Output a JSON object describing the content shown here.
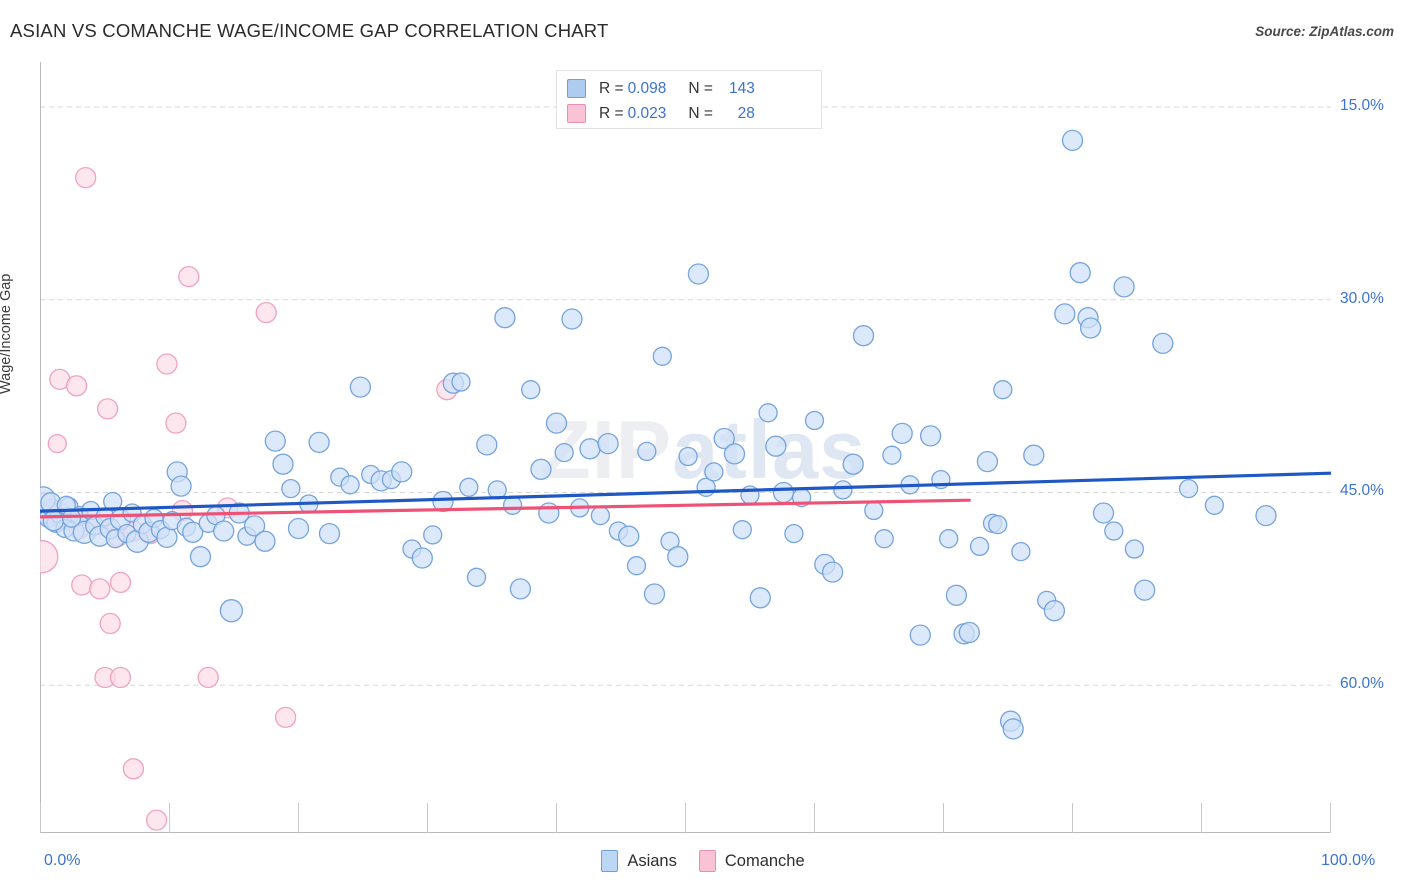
{
  "header": {
    "title": "ASIAN VS COMANCHE WAGE/INCOME GAP CORRELATION CHART",
    "source": "Source: ZipAtlas.com"
  },
  "watermark": {
    "part1": "ZIP",
    "part2": "atlas"
  },
  "stats_legend": {
    "rows": [
      {
        "series": "Asians",
        "r_label": "R =",
        "r_value": "0.098",
        "n_label": "N =",
        "n_value": "143",
        "color": "#aecbf0"
      },
      {
        "series": "Comanche",
        "r_label": "R =",
        "r_value": "0.023",
        "n_label": "N =",
        "n_value": "28",
        "color": "#f9c2d5"
      }
    ]
  },
  "series_legend": [
    {
      "label": "Asians",
      "color": "#bcd6f5",
      "border": "#6f9fdb"
    },
    {
      "label": "Comanche",
      "color": "#f9c2d5",
      "border": "#e58fb2"
    }
  ],
  "axes": {
    "y_title": "Wage/Income Gap",
    "y_ticks": [
      "60.0%",
      "45.0%",
      "30.0%",
      "15.0%"
    ],
    "x_min": "0.0%",
    "x_max": "100.0%"
  },
  "chart_data": {
    "type": "scatter",
    "title": "ASIAN VS COMANCHE WAGE/INCOME GAP CORRELATION CHART",
    "xlabel": "",
    "ylabel": "Wage/Income Gap",
    "xlim": [
      0,
      100
    ],
    "ylim": [
      3.5,
      63.5
    ],
    "grid": true,
    "x_tick_values": [
      0,
      100
    ],
    "y_tick_values": [
      15,
      30,
      45,
      60
    ],
    "legend_position": "bottom-center",
    "series": [
      {
        "name": "Asians",
        "color": "#cfe1f8",
        "border": "#6f9fdb",
        "r": 0.098,
        "n": 143,
        "trendline": {
          "x0": 0,
          "y0": 28.55,
          "x1": 100,
          "y1": 31.5,
          "color": "#1f58c4"
        },
        "points": [
          [
            0.3,
            28.3,
            9
          ],
          [
            0.6,
            28.0,
            9
          ],
          [
            0.9,
            28.8,
            9
          ],
          [
            1.2,
            27.6,
            9
          ],
          [
            1.5,
            28.4,
            10
          ],
          [
            1.9,
            27.2,
            9
          ],
          [
            2.2,
            28.9,
            9
          ],
          [
            2.6,
            27.0,
            10
          ],
          [
            3.0,
            28.2,
            9
          ],
          [
            3.4,
            26.9,
            11
          ],
          [
            3.9,
            28.6,
            9
          ],
          [
            4.2,
            27.4,
            9
          ],
          [
            4.6,
            26.6,
            10
          ],
          [
            5.0,
            28.1,
            9
          ],
          [
            5.4,
            27.2,
            10
          ],
          [
            5.8,
            26.4,
            9
          ],
          [
            6.2,
            27.9,
            10
          ],
          [
            6.7,
            26.8,
            9
          ],
          [
            7.1,
            28.4,
            9
          ],
          [
            7.5,
            26.2,
            11
          ],
          [
            7.9,
            27.5,
            9
          ],
          [
            8.4,
            26.9,
            10
          ],
          [
            8.8,
            28.0,
            9
          ],
          [
            9.3,
            27.1,
            9
          ],
          [
            9.8,
            26.5,
            10
          ],
          [
            10.2,
            27.8,
            9
          ],
          [
            10.6,
            31.6,
            10
          ],
          [
            10.9,
            30.5,
            10
          ],
          [
            11.3,
            27.3,
            9
          ],
          [
            11.8,
            26.9,
            10
          ],
          [
            12.4,
            25.0,
            10
          ],
          [
            13.0,
            27.6,
            9
          ],
          [
            13.6,
            28.2,
            9
          ],
          [
            14.2,
            27.0,
            10
          ],
          [
            14.8,
            20.8,
            11
          ],
          [
            15.4,
            28.4,
            10
          ],
          [
            16.0,
            26.6,
            9
          ],
          [
            16.6,
            27.4,
            10
          ],
          [
            17.4,
            26.2,
            10
          ],
          [
            18.2,
            34.0,
            10
          ],
          [
            18.8,
            32.2,
            10
          ],
          [
            19.4,
            30.3,
            9
          ],
          [
            20.0,
            27.2,
            10
          ],
          [
            20.8,
            29.1,
            9
          ],
          [
            21.6,
            33.9,
            10
          ],
          [
            22.4,
            26.8,
            10
          ],
          [
            23.2,
            31.2,
            9
          ],
          [
            24.0,
            30.6,
            9
          ],
          [
            24.8,
            38.2,
            10
          ],
          [
            25.6,
            31.4,
            9
          ],
          [
            26.4,
            30.9,
            10
          ],
          [
            27.2,
            31.0,
            9
          ],
          [
            28.0,
            31.6,
            10
          ],
          [
            28.8,
            25.6,
            9
          ],
          [
            29.6,
            24.9,
            10
          ],
          [
            30.4,
            26.7,
            9
          ],
          [
            31.2,
            29.3,
            10
          ],
          [
            32.0,
            38.5,
            10
          ],
          [
            32.6,
            38.6,
            9
          ],
          [
            33.2,
            30.4,
            9
          ],
          [
            33.8,
            23.4,
            9
          ],
          [
            34.6,
            33.7,
            10
          ],
          [
            35.4,
            30.2,
            9
          ],
          [
            36.0,
            43.6,
            10
          ],
          [
            36.6,
            29.0,
            9
          ],
          [
            37.2,
            22.5,
            10
          ],
          [
            38.0,
            38.0,
            9
          ],
          [
            38.8,
            31.8,
            10
          ],
          [
            39.4,
            28.4,
            10
          ],
          [
            40.0,
            35.4,
            10
          ],
          [
            40.6,
            33.1,
            9
          ],
          [
            41.2,
            43.5,
            10
          ],
          [
            41.8,
            28.8,
            9
          ],
          [
            42.6,
            33.4,
            10
          ],
          [
            43.4,
            28.2,
            9
          ],
          [
            44.0,
            33.8,
            10
          ],
          [
            44.8,
            27.0,
            9
          ],
          [
            45.6,
            26.6,
            10
          ],
          [
            46.2,
            24.3,
            9
          ],
          [
            47.0,
            33.2,
            9
          ],
          [
            47.6,
            22.1,
            10
          ],
          [
            48.2,
            40.6,
            9
          ],
          [
            48.8,
            26.2,
            9
          ],
          [
            49.4,
            25.0,
            10
          ],
          [
            50.2,
            32.8,
            9
          ],
          [
            51.0,
            47.0,
            10
          ],
          [
            51.6,
            30.4,
            9
          ],
          [
            52.2,
            31.6,
            9
          ],
          [
            53.0,
            34.2,
            10
          ],
          [
            53.8,
            33.0,
            10
          ],
          [
            54.4,
            27.1,
            9
          ],
          [
            55.0,
            29.8,
            9
          ],
          [
            55.8,
            21.8,
            10
          ],
          [
            56.4,
            36.2,
            9
          ],
          [
            57.0,
            33.6,
            10
          ],
          [
            57.6,
            30.0,
            10
          ],
          [
            58.4,
            26.8,
            9
          ],
          [
            59.0,
            29.6,
            9
          ],
          [
            60.0,
            35.6,
            9
          ],
          [
            60.8,
            24.4,
            10
          ],
          [
            61.4,
            23.8,
            10
          ],
          [
            62.2,
            30.2,
            9
          ],
          [
            63.0,
            32.2,
            10
          ],
          [
            63.8,
            42.2,
            10
          ],
          [
            64.6,
            28.6,
            9
          ],
          [
            65.4,
            26.4,
            9
          ],
          [
            66.0,
            32.9,
            9
          ],
          [
            66.8,
            34.6,
            10
          ],
          [
            67.4,
            30.6,
            9
          ],
          [
            68.2,
            18.9,
            10
          ],
          [
            69.0,
            34.4,
            10
          ],
          [
            69.8,
            31.0,
            9
          ],
          [
            70.4,
            26.4,
            9
          ],
          [
            71.0,
            22.0,
            10
          ],
          [
            71.6,
            19.0,
            10
          ],
          [
            72.0,
            19.1,
            10
          ],
          [
            72.8,
            25.8,
            9
          ],
          [
            73.4,
            32.4,
            10
          ],
          [
            73.8,
            27.6,
            9
          ],
          [
            74.2,
            27.5,
            9
          ],
          [
            74.6,
            38.0,
            9
          ],
          [
            75.2,
            12.2,
            10
          ],
          [
            75.4,
            11.6,
            10
          ],
          [
            76.0,
            25.4,
            9
          ],
          [
            77.0,
            32.9,
            10
          ],
          [
            78.0,
            21.6,
            9
          ],
          [
            78.6,
            20.8,
            10
          ],
          [
            79.4,
            43.9,
            10
          ],
          [
            80.0,
            57.4,
            10
          ],
          [
            80.6,
            47.1,
            10
          ],
          [
            81.2,
            43.6,
            10
          ],
          [
            81.4,
            42.8,
            10
          ],
          [
            82.4,
            28.4,
            10
          ],
          [
            83.2,
            27.0,
            9
          ],
          [
            84.0,
            46.0,
            10
          ],
          [
            84.8,
            25.6,
            9
          ],
          [
            85.6,
            22.4,
            10
          ],
          [
            87.0,
            41.6,
            10
          ],
          [
            89.0,
            30.3,
            9
          ],
          [
            91.0,
            29.0,
            9
          ],
          [
            95.0,
            28.2,
            10
          ],
          [
            0.2,
            29.5,
            12
          ],
          [
            0.8,
            29.2,
            10
          ],
          [
            1.0,
            27.8,
            10
          ],
          [
            2.0,
            29.0,
            9
          ],
          [
            2.4,
            28.0,
            9
          ],
          [
            5.6,
            29.3,
            9
          ]
        ]
      },
      {
        "name": "Comanche",
        "color": "#fcdce8",
        "border": "#ef9dbd",
        "r": 0.023,
        "n": 28,
        "trendline": {
          "x0": 0,
          "y0": 28.1,
          "x1": 72,
          "y1": 29.4,
          "color": "#ef5277"
        },
        "points": [
          [
            3.5,
            54.5,
            10
          ],
          [
            11.5,
            46.8,
            10
          ],
          [
            17.5,
            44.0,
            10
          ],
          [
            1.5,
            38.8,
            10
          ],
          [
            2.8,
            38.3,
            10
          ],
          [
            5.2,
            36.5,
            10
          ],
          [
            9.8,
            40.0,
            10
          ],
          [
            10.5,
            35.4,
            10
          ],
          [
            1.3,
            33.8,
            9
          ],
          [
            31.5,
            38.0,
            10
          ],
          [
            0.4,
            29.2,
            10
          ],
          [
            0.7,
            28.4,
            10
          ],
          [
            2.0,
            28.0,
            11
          ],
          [
            3.0,
            27.2,
            10
          ],
          [
            4.5,
            27.5,
            10
          ],
          [
            6.0,
            26.6,
            10
          ],
          [
            7.2,
            27.0,
            10
          ],
          [
            8.5,
            26.8,
            10
          ],
          [
            11.0,
            28.6,
            10
          ],
          [
            14.5,
            28.8,
            10
          ],
          [
            0.1,
            25.0,
            16
          ],
          [
            3.2,
            22.8,
            10
          ],
          [
            4.6,
            22.5,
            10
          ],
          [
            6.2,
            23.0,
            10
          ],
          [
            5.4,
            19.8,
            10
          ],
          [
            5.0,
            15.6,
            10
          ],
          [
            6.2,
            15.6,
            10
          ],
          [
            13.0,
            15.6,
            10
          ],
          [
            19.0,
            12.5,
            10
          ],
          [
            7.2,
            8.5,
            10
          ],
          [
            9.0,
            4.5,
            10
          ]
        ]
      }
    ]
  }
}
